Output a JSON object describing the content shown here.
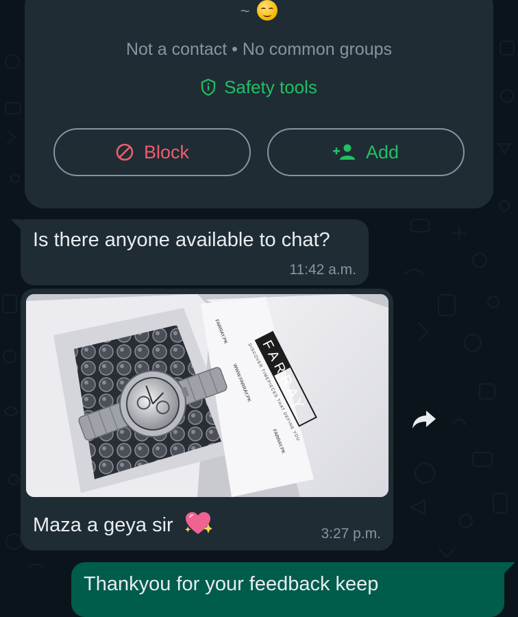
{
  "contact_card": {
    "name_prefix": "~",
    "emoji_icon": "smiling-face-emoji",
    "status_text": "Not a contact • No common groups",
    "safety_tools_label": "Safety tools",
    "block_label": "Block",
    "add_label": "Add"
  },
  "messages": [
    {
      "direction": "incoming",
      "text": "Is there anyone available to chat?",
      "time": "11:42 a.m."
    },
    {
      "direction": "incoming",
      "type": "image",
      "image_subject": "silver wristwatch in FARRAY gift box with bubble wrap",
      "box_brand": "FARRAY",
      "box_tagline": "DISCOVER TIMEPIECES THAT DEFINE YOU",
      "box_website": "WWW.FARRAY.PK",
      "box_social_1": "FARRAY.PK",
      "box_social_2": "FARRAY.PK",
      "caption": "Maza a geya sir",
      "caption_emoji": "sparkling-heart-emoji",
      "time": "3:27 p.m."
    },
    {
      "direction": "outgoing",
      "text": "Thankyou for your feedback keep"
    }
  ],
  "colors": {
    "background": "#0b141a",
    "incoming_bubble": "#1f2c34",
    "outgoing_bubble": "#005c4b",
    "accent_green": "#21c063",
    "block_red": "#f15c6d",
    "secondary_text": "#8696a0"
  },
  "icons": {
    "safety": "shield-icon",
    "block": "block-icon",
    "add": "add-person-icon",
    "forward": "forward-icon"
  }
}
